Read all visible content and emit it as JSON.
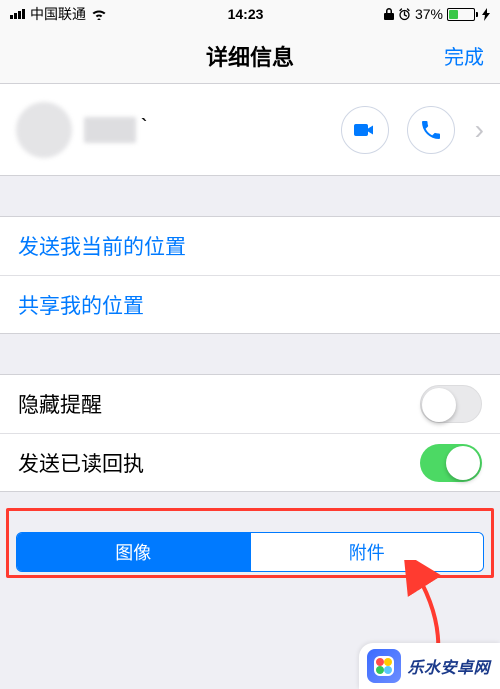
{
  "status": {
    "carrier": "中国联通",
    "time": "14:23",
    "battery_pct": "37%"
  },
  "nav": {
    "title": "详细信息",
    "done": "完成"
  },
  "contact": {
    "name_visible_suffix": "｀"
  },
  "location_group": {
    "send_current": "发送我当前的位置",
    "share_location": "共享我的位置"
  },
  "toggles": {
    "hide_alerts": {
      "label": "隐藏提醒",
      "on": false
    },
    "read_receipts": {
      "label": "发送已读回执",
      "on": true
    }
  },
  "segments": {
    "images": "图像",
    "attachments": "附件"
  },
  "watermark": "乐水安卓网"
}
